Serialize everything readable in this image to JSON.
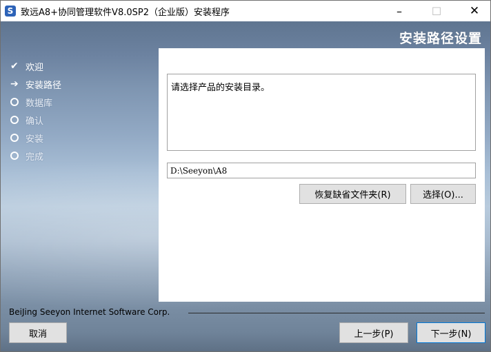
{
  "window": {
    "title": "致远A8+协同管理软件V8.0SP2（企业版）安装程序",
    "app_icon_glyph": "S",
    "minimize_glyph": "–",
    "maximize_glyph": "☐",
    "close_glyph": "✕"
  },
  "header": {
    "page_title": "安装路径设置"
  },
  "steps": [
    {
      "label": "欢迎",
      "state": "done",
      "mark": "✔"
    },
    {
      "label": "安装路径",
      "state": "current",
      "mark": "➔"
    },
    {
      "label": "数据库",
      "state": "pending"
    },
    {
      "label": "确认",
      "state": "pending"
    },
    {
      "label": "安装",
      "state": "pending"
    },
    {
      "label": "完成",
      "state": "pending"
    }
  ],
  "panel": {
    "description": "请选择产品的安装目录。",
    "install_path": "D:\\Seeyon\\A8",
    "restore_button": "恢复缺省文件夹(R)",
    "choose_button": "选择(O)..."
  },
  "footer": {
    "company": "BeiJing Seeyon Internet Software Corp.",
    "cancel_button": "取消",
    "prev_button": "上一步(P)",
    "next_button": "下一步(N)"
  },
  "colors": {
    "accent": "#0078d7",
    "button_face": "#e1e1e1",
    "background_top": "#5f7590",
    "background_mid": "#b8cbdd"
  }
}
